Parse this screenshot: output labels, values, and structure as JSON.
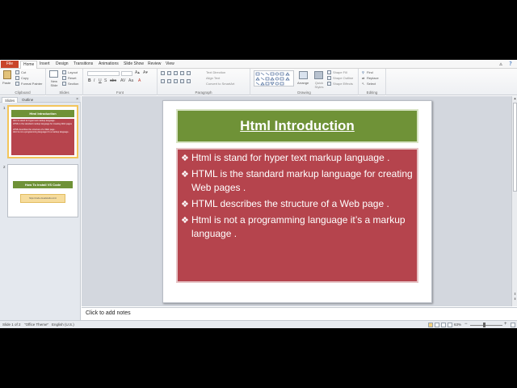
{
  "tabs": [
    "File",
    "Home",
    "Insert",
    "Design",
    "Transitions",
    "Animations",
    "Slide Show",
    "Review",
    "View"
  ],
  "active_tab": "Home",
  "ribbon": {
    "clipboard": {
      "label": "Clipboard",
      "paste": "Paste",
      "cut": "Cut",
      "copy": "Copy",
      "format_painter": "Format Painter"
    },
    "slides": {
      "label": "Slides",
      "new_slide": "New Slide",
      "layout": "Layout",
      "reset": "Reset",
      "section": "Section"
    },
    "font": {
      "label": "Font"
    },
    "paragraph": {
      "label": "Paragraph",
      "text_direction": "Text Direction",
      "align_text": "Align Text",
      "convert_smartart": "Convert to SmartArt"
    },
    "drawing": {
      "label": "Drawing",
      "arrange": "Arrange",
      "quick_styles": "Quick Styles",
      "shape_fill": "Shape Fill",
      "shape_outline": "Shape Outline",
      "shape_effects": "Shape Effects"
    },
    "editing": {
      "label": "Editing",
      "find": "Find",
      "replace": "Replace",
      "select": "Select"
    }
  },
  "pane": {
    "tab_slides": "Slides",
    "tab_outline": "Outline",
    "close": "×"
  },
  "thumbnails": [
    {
      "number": "1",
      "title": "Html Introduction",
      "lines": [
        "Html is stand for hyper text markup language .",
        "HTML is the standard markup language for creating Web pages .",
        "HTML describes the structure of a Web page .",
        "Html is not a programming language it's a markup language ."
      ]
    },
    {
      "number": "2",
      "title": "How To Install VS Code",
      "link": "https://code.visualstudio.com/"
    }
  ],
  "slide": {
    "title": "Html Introduction",
    "bullet_symbol": "❖",
    "bullets": [
      "Html is stand for hyper text markup language .",
      "HTML is the standard markup language for creating Web pages .",
      "HTML describes the structure of a Web page .",
      "Html is not a programming language it’s a markup language ."
    ]
  },
  "notes_placeholder": "Click to add notes",
  "status": {
    "slide_info": "Slide 1 of 2",
    "theme": "\"Office Theme\"",
    "language": "English (U.S.)",
    "zoom": "63%"
  },
  "colors": {
    "title_green": "#6f9237",
    "body_red": "#b5444d",
    "file_tab": "#c9452a"
  }
}
